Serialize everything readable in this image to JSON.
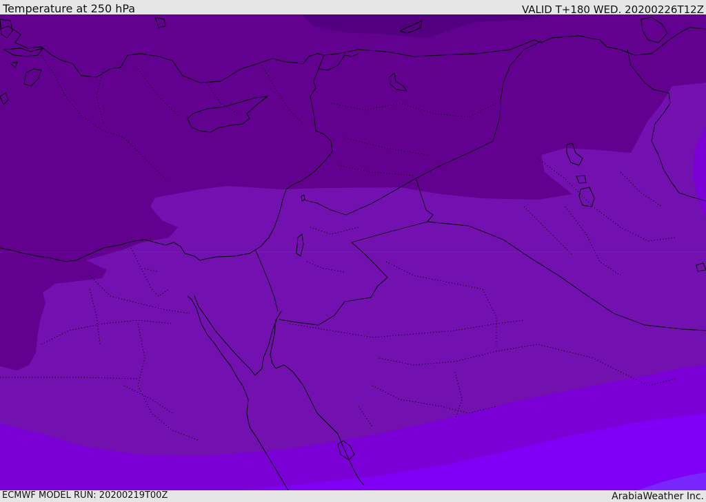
{
  "header": {
    "title": "Temperature at 250 hPa",
    "valid": "VALID T+180 WED. 20200226T12Z"
  },
  "footer": {
    "model_run": "ECMWF MODEL RUN: 20200219T00Z",
    "credit": "ArabiaWeather Inc."
  },
  "colors": {
    "band_coldest": "#520080",
    "band_cold": "#62008f",
    "band_mid": "#7210b0",
    "band_warm": "#7a00d6",
    "band_warmer": "#7f00f5",
    "band_warmest": "#7a26ff",
    "coastline": "#000000",
    "header_bg": "#e6e6e6"
  }
}
